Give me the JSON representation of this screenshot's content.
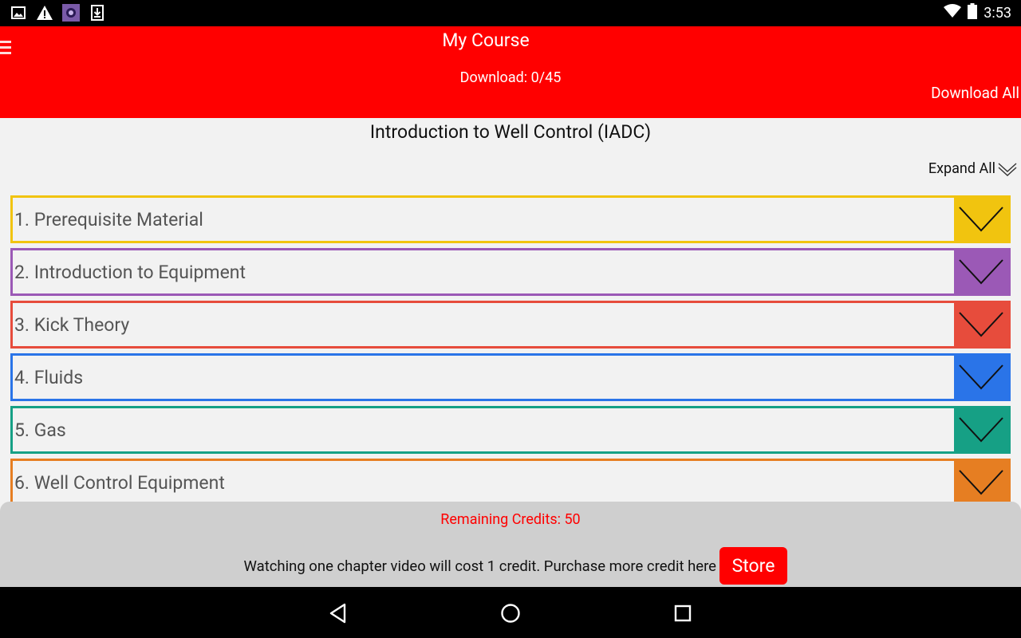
{
  "status_bar": {
    "time": "3:53",
    "left_icons": [
      "image-icon",
      "warning-icon",
      "app-thumbnail-icon",
      "download-icon"
    ],
    "right_icons": [
      "wifi-icon",
      "battery-icon"
    ]
  },
  "header": {
    "title": "My Course",
    "download_status": "Download: 0/45",
    "download_all_label": "Download All",
    "background": "#ff0000"
  },
  "course": {
    "title": "Introduction to Well Control (IADC)",
    "expand_all_label": "Expand All"
  },
  "chapters": [
    {
      "label": "1. Prerequisite Material",
      "color": "#f1c40f"
    },
    {
      "label": "2. Introduction to Equipment",
      "color": "#9b59b6"
    },
    {
      "label": "3. Kick Theory",
      "color": "#e74c3c"
    },
    {
      "label": "4. Fluids",
      "color": "#2a74e8"
    },
    {
      "label": "5. Gas",
      "color": "#16a085"
    },
    {
      "label": "6. Well Control Equipment",
      "color": "#e67e22"
    }
  ],
  "credits": {
    "remaining": "Remaining Credits: 50",
    "purchase_text": "Watching one chapter video will cost 1 credit. Purchase more credit here",
    "store_label": "Store"
  },
  "nav_bar": {
    "buttons": [
      "back-icon",
      "home-icon",
      "recents-icon"
    ]
  }
}
